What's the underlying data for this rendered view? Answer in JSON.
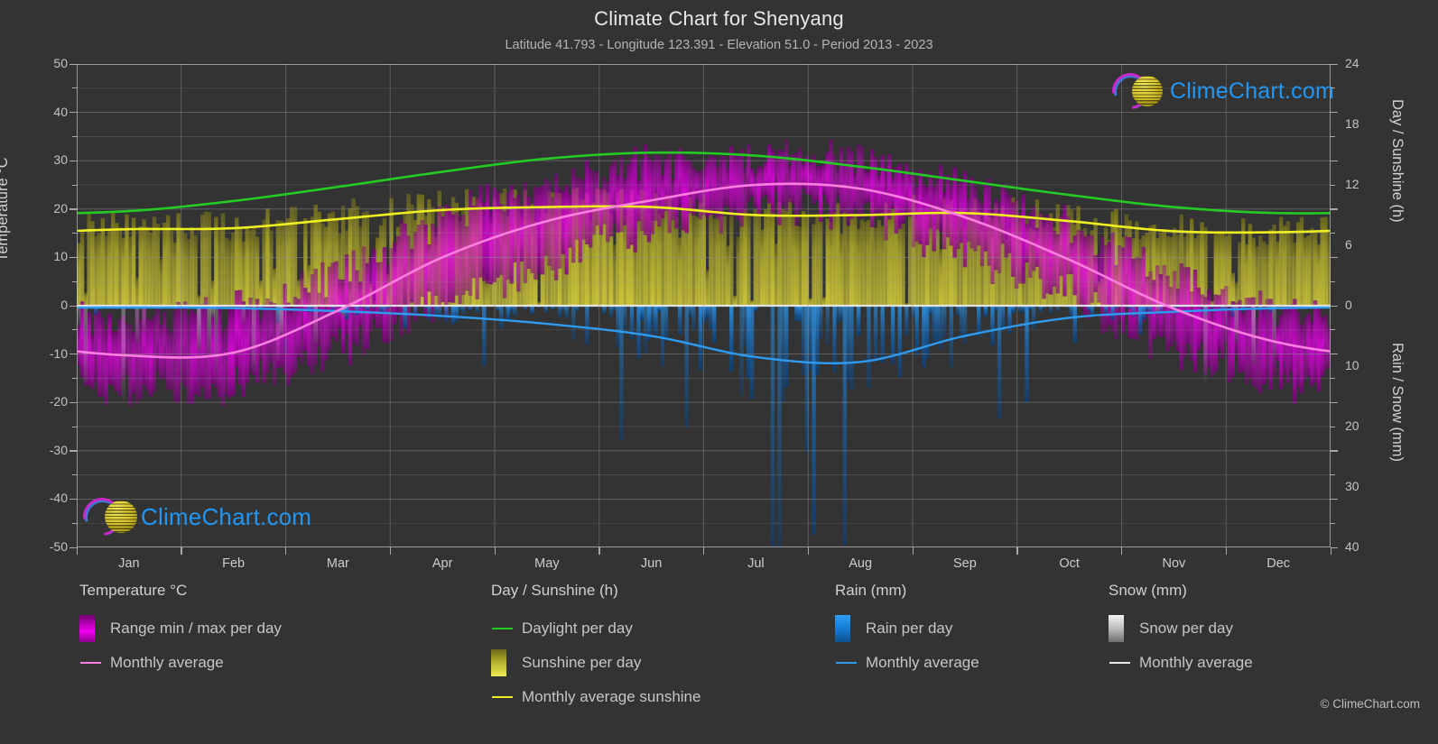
{
  "header": {
    "title": "Climate Chart for Shenyang",
    "subtitle": "Latitude 41.793 - Longitude 123.391 - Elevation 51.0 - Period 2013 - 2023"
  },
  "branding": {
    "wordmark": "ClimeChart.com",
    "copyright": "© ClimeChart.com"
  },
  "legend": {
    "temperature": {
      "heading": "Temperature °C",
      "items": [
        {
          "label": "Range min / max per day",
          "type": "box",
          "color": "#e000e0"
        },
        {
          "label": "Monthly average",
          "type": "line",
          "color": "#ff7fe0"
        }
      ]
    },
    "daysunshine": {
      "heading": "Day / Sunshine (h)",
      "items": [
        {
          "label": "Daylight per day",
          "type": "line",
          "color": "#22cc22"
        },
        {
          "label": "Sunshine per day",
          "type": "box",
          "color": "#e8e23a"
        },
        {
          "label": "Monthly average sunshine",
          "type": "line",
          "color": "#efef20"
        }
      ]
    },
    "rain": {
      "heading": "Rain (mm)",
      "items": [
        {
          "label": "Rain per day",
          "type": "box",
          "color": "#1f8fe0"
        },
        {
          "label": "Monthly average",
          "type": "line",
          "color": "#2e9bf0"
        }
      ]
    },
    "snow": {
      "heading": "Snow (mm)",
      "items": [
        {
          "label": "Snow per day",
          "type": "box",
          "color": "#dcdcdc"
        },
        {
          "label": "Monthly average",
          "type": "line",
          "color": "#e8e8e8"
        }
      ]
    }
  },
  "chart_data": {
    "type": "line",
    "title": "Climate Chart for Shenyang",
    "subtitle": "Latitude 41.793 - Longitude 123.391 - Elevation 51.0 - Period 2013 - 2023",
    "xlabel": "",
    "x_tick_labels": [
      "Jan",
      "Feb",
      "Mar",
      "Apr",
      "May",
      "Jun",
      "Jul",
      "Aug",
      "Sep",
      "Oct",
      "Nov",
      "Dec"
    ],
    "grid": true,
    "legend_position": "bottom",
    "axes": {
      "left": {
        "label": "Temperature °C",
        "ticks": [
          50,
          40,
          30,
          20,
          10,
          0,
          -10,
          -20,
          -30,
          -40,
          -50
        ],
        "range": [
          -50,
          50
        ],
        "minor_step": 5
      },
      "right_top": {
        "label": "Day / Sunshine (h)",
        "ticks": [
          24,
          18,
          12,
          6,
          0
        ],
        "range": [
          0,
          24
        ],
        "maps_to_temperature": [
          0,
          50
        ]
      },
      "right_bottom": {
        "label": "Rain / Snow (mm)",
        "ticks": [
          0,
          10,
          20,
          30,
          40
        ],
        "range": [
          0,
          40
        ],
        "maps_to_temperature": [
          0,
          -50
        ]
      }
    },
    "series": [
      {
        "name": "Monthly average temperature",
        "unit": "°C",
        "axis": "left",
        "color": "#ff7fe0",
        "categories": [
          "Jan",
          "Feb",
          "Mar",
          "Apr",
          "May",
          "Jun",
          "Jul",
          "Aug",
          "Sep",
          "Oct",
          "Nov",
          "Dec"
        ],
        "values": [
          -10.3,
          -9.7,
          -1.0,
          10.0,
          17.5,
          21.8,
          25.0,
          24.2,
          18.3,
          9.5,
          -0.6,
          -7.6
        ]
      },
      {
        "name": "Daily max temperature envelope",
        "unit": "°C",
        "axis": "left",
        "color": "#cc00cc",
        "categories": [
          "Jan",
          "Feb",
          "Mar",
          "Apr",
          "May",
          "Jun",
          "Jul",
          "Aug",
          "Sep",
          "Oct",
          "Nov",
          "Dec"
        ],
        "values": [
          -3.0,
          -1.0,
          7.0,
          18.0,
          25.0,
          29.5,
          31.0,
          30.0,
          25.0,
          17.0,
          6.0,
          -1.5
        ]
      },
      {
        "name": "Daily min temperature envelope",
        "unit": "°C",
        "axis": "left",
        "color": "#cc00cc",
        "categories": [
          "Jan",
          "Feb",
          "Mar",
          "Apr",
          "May",
          "Jun",
          "Jul",
          "Aug",
          "Sep",
          "Oct",
          "Nov",
          "Dec"
        ],
        "values": [
          -18.0,
          -17.0,
          -9.0,
          1.0,
          9.0,
          16.0,
          20.0,
          19.0,
          11.0,
          2.0,
          -9.0,
          -15.0
        ]
      },
      {
        "name": "Daylight per day",
        "unit": "h",
        "axis": "right_top",
        "color": "#22cc22",
        "categories": [
          "Jan",
          "Feb",
          "Mar",
          "Apr",
          "May",
          "Jun",
          "Jul",
          "Aug",
          "Sep",
          "Oct",
          "Nov",
          "Dec"
        ],
        "values": [
          9.4,
          10.4,
          11.8,
          13.3,
          14.6,
          15.2,
          14.9,
          13.8,
          12.4,
          11.0,
          9.8,
          9.2
        ]
      },
      {
        "name": "Monthly average sunshine",
        "unit": "h",
        "axis": "right_top",
        "color": "#efef20",
        "categories": [
          "Jan",
          "Feb",
          "Mar",
          "Apr",
          "May",
          "Jun",
          "Jul",
          "Aug",
          "Sep",
          "Oct",
          "Nov",
          "Dec"
        ],
        "values": [
          7.6,
          7.7,
          8.6,
          9.5,
          9.8,
          9.8,
          9.0,
          9.0,
          9.2,
          8.4,
          7.4,
          7.3
        ]
      },
      {
        "name": "Monthly average rain",
        "unit": "mm",
        "axis": "right_bottom",
        "color": "#2e9bf0",
        "categories": [
          "Jan",
          "Feb",
          "Mar",
          "Apr",
          "May",
          "Jun",
          "Jul",
          "Aug",
          "Sep",
          "Oct",
          "Nov",
          "Dec"
        ],
        "values": [
          0.3,
          0.4,
          0.9,
          1.7,
          3.0,
          5.0,
          8.5,
          9.3,
          5.0,
          2.0,
          1.0,
          0.4
        ]
      }
    ],
    "notes": "Vertical bands show per-day values: magenta = daily temperature min/max range, yellow = sunshine hours per day, blue = rain per day (below zero line), light gray = snow per day (below zero line)."
  }
}
